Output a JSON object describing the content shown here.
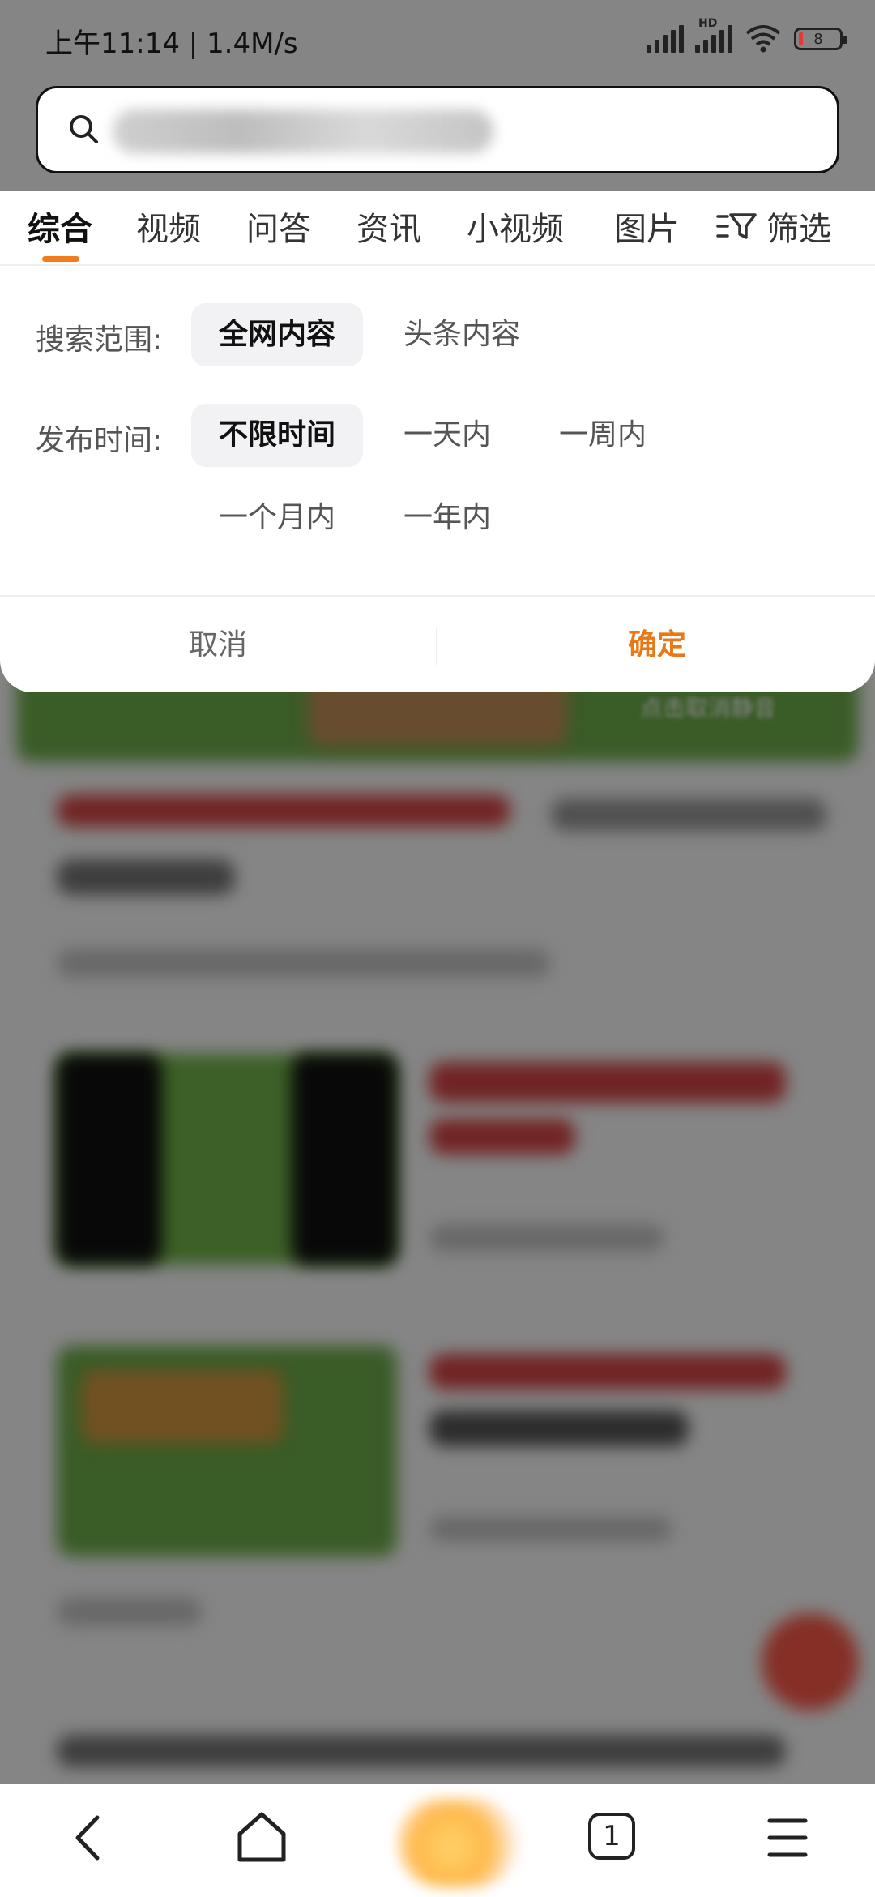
{
  "status_bar": {
    "time": "上午11:14 | 1.4M/s",
    "battery": "8"
  },
  "search": {
    "value": "",
    "icon": "search-icon"
  },
  "tabs": [
    {
      "label": "综合",
      "active": true
    },
    {
      "label": "视频"
    },
    {
      "label": "问答"
    },
    {
      "label": "资讯"
    },
    {
      "label": "小视频"
    },
    {
      "label": "图片"
    }
  ],
  "filter": {
    "label": "筛选",
    "icon": "filter-icon"
  },
  "panel": {
    "scope_label": "搜索范围:",
    "scope_options": [
      "全网内容",
      "头条内容"
    ],
    "scope_selected": "全网内容",
    "time_label": "发布时间:",
    "time_options": [
      "不限时间",
      "一天内",
      "一周内",
      "一个月内",
      "一年内"
    ],
    "time_selected": "不限时间",
    "cancel_label": "取消",
    "confirm_label": "确定"
  },
  "background": {
    "mute_hint": "点击取消静音"
  },
  "bottom_nav": {
    "tab_count": "1"
  },
  "colors": {
    "accent": "#f07c1b",
    "confirm": "#e87919",
    "selected_bg": "#f2f2f4"
  }
}
